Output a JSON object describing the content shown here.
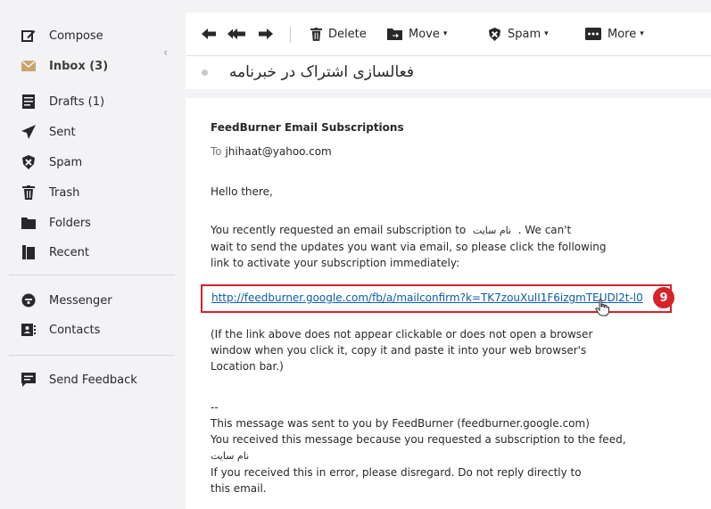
{
  "sidebar": {
    "items": [
      {
        "label": "Compose",
        "icon": "compose-icon"
      },
      {
        "label": "Inbox (3)",
        "icon": "inbox-icon"
      },
      {
        "label": "Drafts (1)",
        "icon": "drafts-icon"
      },
      {
        "label": "Sent",
        "icon": "sent-icon"
      },
      {
        "label": "Spam",
        "icon": "spam-icon"
      },
      {
        "label": "Trash",
        "icon": "trash-icon"
      },
      {
        "label": "Folders",
        "icon": "folder-icon"
      },
      {
        "label": "Recent",
        "icon": "recent-icon"
      },
      {
        "label": "Messenger",
        "icon": "messenger-icon"
      },
      {
        "label": "Contacts",
        "icon": "contacts-icon"
      },
      {
        "label": "Send Feedback",
        "icon": "feedback-icon"
      }
    ]
  },
  "toolbar": {
    "delete_label": "Delete",
    "move_label": "Move",
    "spam_label": "Spam",
    "more_label": "More"
  },
  "message": {
    "subject": "فعالسازی اشتراک در خبرنامه",
    "sender": "FeedBurner Email Subscriptions",
    "to_label": "To",
    "to_address": "jhihaat@yahoo.com",
    "greeting": "Hello there,",
    "para1_a": "You recently requested an email subscription to",
    "site_name": "نام سایت",
    "para1_b": ". We can't",
    "para1_line2": "wait to send the updates you want via email, so please click the following",
    "para1_line3": "link to activate your subscription immediately:",
    "confirm_link": "http://feedburner.google.com/fb/a/mailconfirm?k=TK7zouXulI1F6izgmTEUDl2t-l0",
    "para2_line1": "(If the link above does not appear clickable or does not open a browser",
    "para2_line2": "window when you click it, copy it and paste it into your web browser's",
    "para2_line3": "Location bar.)",
    "footer_dashes": "--",
    "footer_line1": "This message was sent to you by FeedBurner (feedburner.google.com)",
    "footer_line2": "You received this message because you requested a subscription to the feed,",
    "footer_site": "نام سایت",
    "footer_line3": "If you received this in error, please disregard.  Do not reply directly to",
    "footer_line4": "this email."
  },
  "annotation": {
    "step": "9"
  },
  "colors": {
    "highlight": "#d6232a",
    "link": "#0b5cad",
    "inbox_icon": "#c9a46a"
  }
}
